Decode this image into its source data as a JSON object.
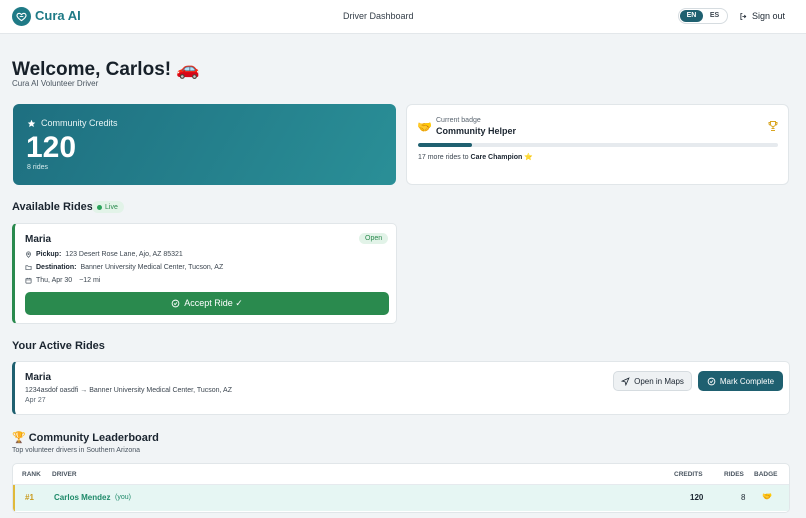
{
  "app": {
    "name": "Cura AI",
    "nav_title": "Driver Dashboard"
  },
  "language": {
    "options": [
      "EN",
      "ES"
    ],
    "selected": "EN"
  },
  "header": {
    "sign_out_label": "Sign out"
  },
  "welcome": {
    "title": "Welcome, Carlos! 🚗",
    "subtitle": "Cura AI Volunteer Driver"
  },
  "credits": {
    "label": "Community Credits",
    "value": "120",
    "rides": "8 rides"
  },
  "badge": {
    "caption": "Current badge",
    "name": "Community Helper",
    "emoji": "🤝",
    "progress": 0.15,
    "next_prefix": "17 more rides to",
    "next_badge": "Care Champion ⭐"
  },
  "available": {
    "title": "Available Rides",
    "live_label": "Live",
    "rides": [
      {
        "name": "Maria",
        "status": "Open",
        "pickup_label": "Pickup:",
        "pickup": "123 Desert Rose Lane, Ajo, AZ 85321",
        "destination_label": "Destination:",
        "destination": "Banner University Medical Center, Tucson, AZ",
        "date": "Thu, Apr 30",
        "distance": "~12 mi",
        "accept_label": "Accept Ride ✓"
      }
    ]
  },
  "active": {
    "title": "Your Active Rides",
    "rides": [
      {
        "name": "Maria",
        "route": "1234asdof oasdfi → Banner University Medical Center, Tucson, AZ",
        "date": "Apr 27",
        "maps_label": "Open in Maps",
        "complete_label": "Mark Complete"
      }
    ]
  },
  "leaderboard": {
    "title": "Community Leaderboard",
    "trophy": "🏆",
    "subtitle": "Top volunteer drivers in Southern Arizona",
    "columns": {
      "rank": "RANK",
      "driver": "DRIVER",
      "credits": "CREDITS",
      "rides": "RIDES",
      "badge": "BADGE"
    },
    "rows": [
      {
        "rank": "#1",
        "driver": "Carlos Mendez",
        "you": "(you)",
        "credits": "120",
        "rides": "8",
        "badge": "🤝"
      }
    ]
  },
  "colors": {
    "brand": "#1f7a86",
    "primary_dark": "#1f6070",
    "success": "#2a8a4e",
    "background": "#f1f4f6"
  }
}
